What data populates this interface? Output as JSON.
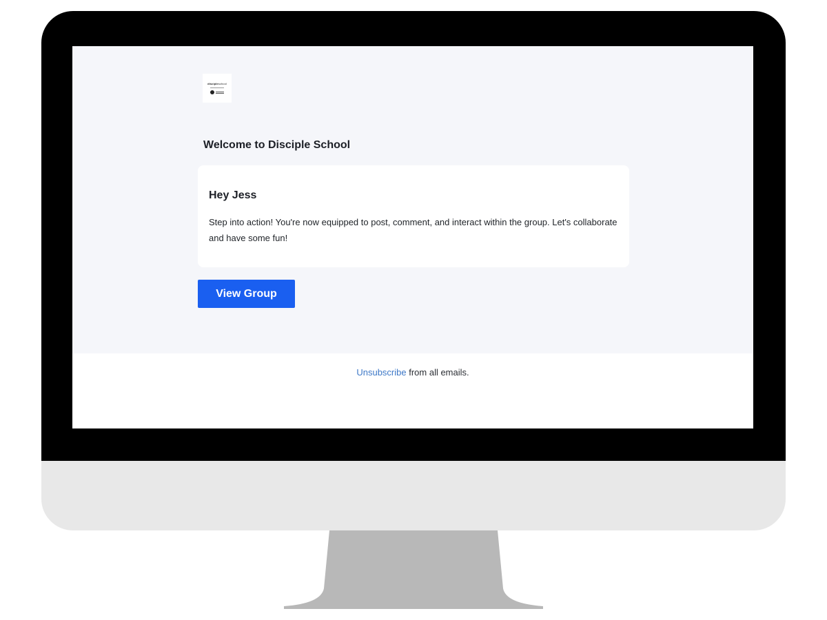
{
  "email": {
    "logo": {
      "word_part1": "disciple",
      "word_part2": "school"
    },
    "heading": "Welcome to Disciple School",
    "card": {
      "greeting": "Hey Jess",
      "message": "Step into action! You're now equipped to post, comment, and interact within the group. Let's collaborate and have some fun!"
    },
    "cta_label": "View Group",
    "footer": {
      "link_text": "Unsubscribe",
      "suffix_text": " from all emails."
    }
  },
  "colors": {
    "monitor_bezel": "#000000",
    "monitor_chin": "#e8e8e8",
    "stand": "#b8b8b8",
    "email_background": "#f5f6fa",
    "button": "#1a5ff0",
    "link": "#3d78c7"
  }
}
